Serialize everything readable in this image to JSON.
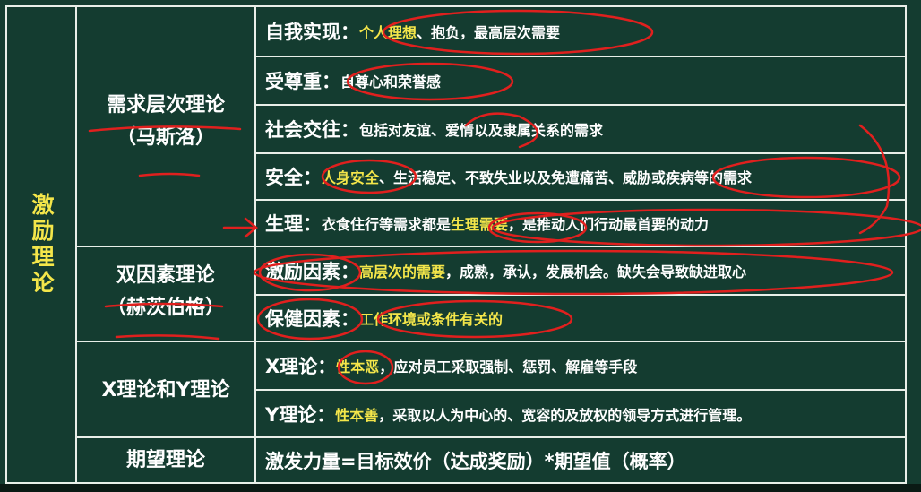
{
  "main_title": "激励理论",
  "theories": {
    "maslow": {
      "name": "需求层次理论",
      "author": "（马斯洛）"
    },
    "herzberg": {
      "name": "双因素理论",
      "author": "（赫茨伯格）"
    },
    "xy": {
      "name": "X理论和Y理论"
    },
    "expectancy": {
      "name": "期望理论"
    }
  },
  "rows": [
    {
      "label": "自我实现：",
      "highlight": "个人理想",
      "desc": "、抱负，最高层次需要"
    },
    {
      "label": "受尊重：",
      "highlight": "",
      "desc": "自尊心和荣誉感"
    },
    {
      "label": "社会交往：",
      "highlight": "",
      "desc": "包括对友谊、爱情以及隶属关系的需求"
    },
    {
      "label": "安全：",
      "highlight": "人身安全",
      "desc": "、生活稳定、不致失业以及免遭痛苦、威胁或疾病等的需求"
    },
    {
      "label": "生理：",
      "pre": "衣食住行等需求都是",
      "highlight": "生理需要",
      "desc": "，是推动人们行动最首要的动力"
    },
    {
      "label": "激励因素：",
      "highlight": "高层次的需要",
      "desc": "，成熟，承认，发展机会。缺失会导致缺进取心"
    },
    {
      "label": "保健因素：",
      "highlight": "工作环境或条件有关的",
      "desc": ""
    },
    {
      "label": "X理论：",
      "highlight": "性本恶",
      "desc": "，应对员工采取强制、惩罚、解雇等手段"
    },
    {
      "label": "Y理论：",
      "highlight": "性本善",
      "desc": "，采取以人为中心的、宽容的及放权的领导方式进行管理。"
    },
    {
      "label": "激发力量=目标效价（达成奖励）*期望值（概率）",
      "highlight": "",
      "desc": ""
    }
  ],
  "colors": {
    "board": "#143c30",
    "highlight": "#f4e64a",
    "ink": "#e0201e",
    "text": "#ffffff"
  }
}
